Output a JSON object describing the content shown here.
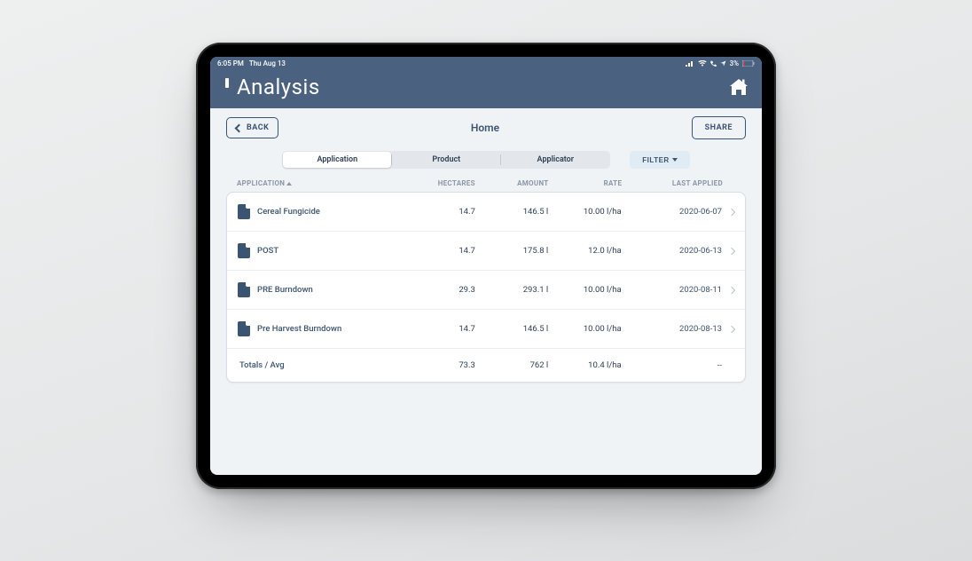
{
  "status": {
    "time": "6:05 PM",
    "date": "Thu Aug 13",
    "battery": "3%"
  },
  "header": {
    "title": "Analysis"
  },
  "toolbar": {
    "back_label": "BACK",
    "title": "Home",
    "share_label": "SHARE"
  },
  "segment": {
    "application": "Application",
    "product": "Product",
    "applicator": "Applicator"
  },
  "filter": {
    "label": "FILTER"
  },
  "columns": {
    "application": "APPLICATION",
    "hectares": "HECTARES",
    "amount": "AMOUNT",
    "rate": "RATE",
    "last_applied": "LAST APPLIED"
  },
  "rows": [
    {
      "name": "Cereal Fungicide",
      "hectares": "14.7",
      "amount": "146.5 l",
      "rate": "10.00 l/ha",
      "last_applied": "2020-06-07"
    },
    {
      "name": "POST",
      "hectares": "14.7",
      "amount": "175.8 l",
      "rate": "12.0 l/ha",
      "last_applied": "2020-06-13"
    },
    {
      "name": "PRE Burndown",
      "hectares": "29.3",
      "amount": "293.1 l",
      "rate": "10.00 l/ha",
      "last_applied": "2020-08-11"
    },
    {
      "name": "Pre Harvest Burndown",
      "hectares": "14.7",
      "amount": "146.5 l",
      "rate": "10.00 l/ha",
      "last_applied": "2020-08-13"
    }
  ],
  "totals": {
    "label": "Totals / Avg",
    "hectares": "73.3",
    "amount": "762 l",
    "rate": "10.4 l/ha",
    "last_applied": "--"
  }
}
